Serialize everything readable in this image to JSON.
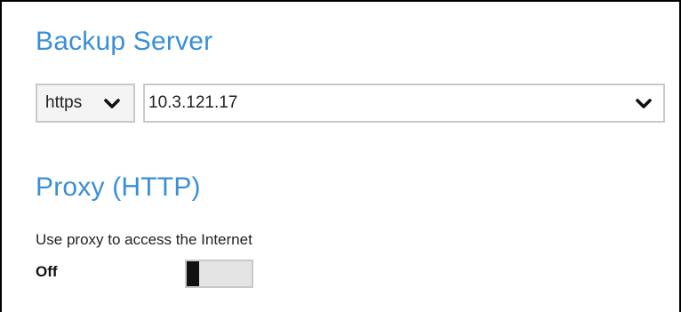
{
  "backup_server": {
    "title": "Backup Server",
    "protocol": {
      "selected": "https"
    },
    "host": {
      "value": "10.3.121.17"
    }
  },
  "proxy": {
    "title": "Proxy (HTTP)",
    "description": "Use proxy to access the Internet",
    "toggle": {
      "state_label": "Off",
      "enabled": false
    }
  },
  "colors": {
    "accent": "#3a8fd6",
    "border": "#c9c9c9",
    "toggle_track": "#e4e4e4",
    "toggle_knob": "#111111"
  },
  "icons": {
    "protocol_dropdown": "chevron-down-icon",
    "host_dropdown": "chevron-down-icon"
  }
}
